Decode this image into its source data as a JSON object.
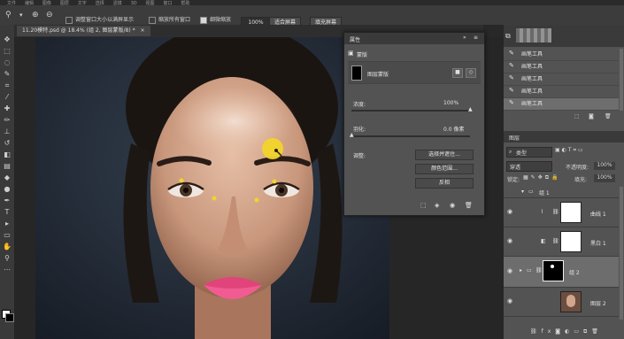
{
  "menu": [
    "文件",
    "编辑",
    "图像",
    "图层",
    "文字",
    "选择",
    "滤镜",
    "3D",
    "视图",
    "窗口",
    "帮助"
  ],
  "options": {
    "resize_windows": "调整窗口大小以满屏显示",
    "zoom_all": "缩放所有窗口",
    "scrubby_zoom": "细微缩放",
    "zoom_value": "100%",
    "fit_screen": "适合屏幕",
    "fill_screen": "填充屏幕"
  },
  "document": {
    "tab_title": "11.20模特.psd @ 18.4% (组 2, 图层蒙版/8) *",
    "close": "×"
  },
  "properties": {
    "panel_title": "属性",
    "section": "蒙版",
    "mask_type": "图层蒙版",
    "density_label": "浓度:",
    "density_value": "100%",
    "density": 1.0,
    "feather_label": "羽化:",
    "feather_value": "0.0 像素",
    "feather": 0.0,
    "refine_label": "调整:",
    "btn_select_mask": "选择并遮住...",
    "btn_color_range": "颜色范围...",
    "btn_invert": "反相"
  },
  "history": {
    "items": [
      "画笔工具",
      "画笔工具",
      "画笔工具",
      "画笔工具",
      "画笔工具"
    ],
    "active_index": 4
  },
  "layers": {
    "panel_title": "图层",
    "filter_kind": "类型",
    "blend_mode": "穿透",
    "opacity_label": "不透明度:",
    "opacity_value": "100%",
    "lock_label": "锁定:",
    "fill_label": "填充:",
    "fill_value": "100%",
    "items": [
      {
        "name": "组 1",
        "type": "group"
      },
      {
        "name": "曲线 1",
        "type": "adjustment"
      },
      {
        "name": "黑白 1",
        "type": "adjustment"
      },
      {
        "name": "组 2",
        "type": "group-mask",
        "selected": true
      },
      {
        "name": "图层 2",
        "type": "pixel"
      }
    ]
  },
  "colors": {
    "accent_yellow": "#f2d42a",
    "panel": "#535353",
    "dark": "#282828"
  }
}
